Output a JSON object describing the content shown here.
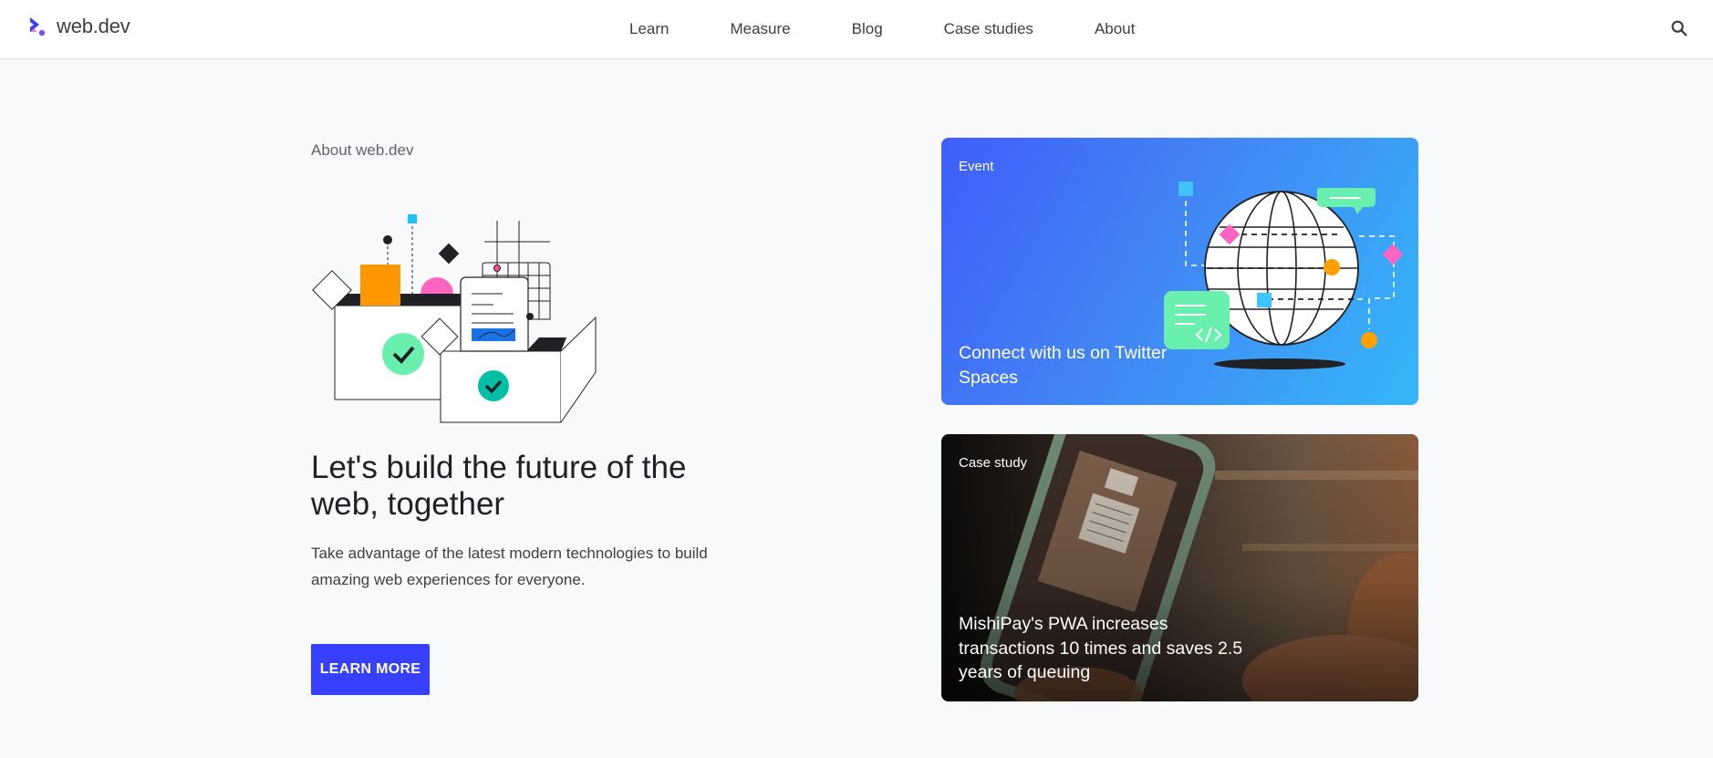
{
  "header": {
    "brand": "web.dev",
    "nav": [
      "Learn",
      "Measure",
      "Blog",
      "Case studies",
      "About"
    ]
  },
  "hero": {
    "eyebrow": "About web.dev",
    "headline": "Let's build the future of the web, together",
    "subtext": "Take advantage of the latest modern technologies to build amazing web experiences for everyone.",
    "cta_label": "LEARN MORE"
  },
  "cards": [
    {
      "tag": "Event",
      "title": "Connect with us on Twitter Spaces"
    },
    {
      "tag": "Case study",
      "title": "MishiPay's PWA increases transactions 10 times and saves 2.5 years of queuing"
    }
  ],
  "colors": {
    "accent": "#3740ff",
    "event_card_start": "#3f5efb",
    "event_card_end": "#34b7f8",
    "page_bg": "#f8f9fa"
  }
}
